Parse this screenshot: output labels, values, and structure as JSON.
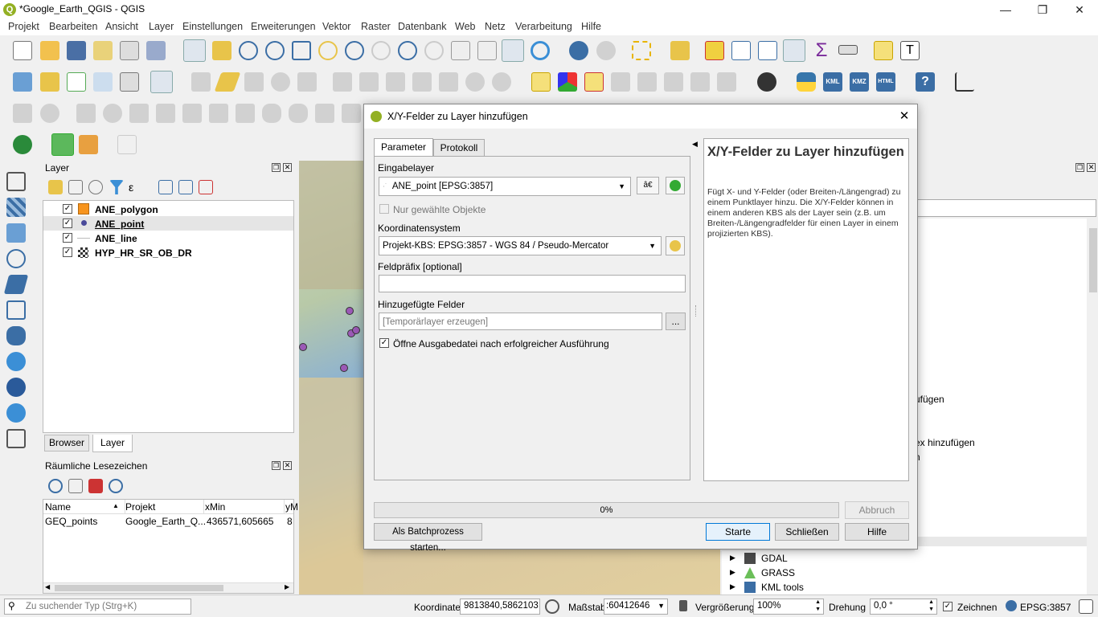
{
  "window": {
    "title": "*Google_Earth_QGIS - QGIS",
    "icon": "qgis-logo-icon"
  },
  "menu": [
    "Projekt",
    "Bearbeiten",
    "Ansicht",
    "Layer",
    "Einstellungen",
    "Erweiterungen",
    "Vektor",
    "Raster",
    "Datenbank",
    "Web",
    "Netz",
    "Verarbeitung",
    "Hilfe"
  ],
  "layers_panel": {
    "title": "Layer",
    "items": [
      {
        "name": "ANE_polygon",
        "checked": true,
        "icon": "polygon-swatch-icon"
      },
      {
        "name": "ANE_point",
        "checked": true,
        "icon": "point-symbol-icon"
      },
      {
        "name": "ANE_line",
        "checked": true,
        "icon": "line-symbol-icon"
      },
      {
        "name": "HYP_HR_SR_OB_DR",
        "checked": true,
        "icon": "raster-icon"
      }
    ],
    "tabs": [
      "Browser",
      "Layer"
    ]
  },
  "bookmarks_panel": {
    "title": "Räumliche Lesezeichen",
    "columns": [
      "Name",
      "Projekt",
      "xMin",
      "yM"
    ],
    "rows": [
      [
        "GEQ_points",
        "Google_Earth_Q...",
        "436571,605665",
        "8"
      ]
    ]
  },
  "toolbox_visible": {
    "items": [
      "GDAL",
      "GRASS",
      "KML tools"
    ],
    "partial_lines": [
      "ufügen",
      "ex hinzufügen",
      "n"
    ]
  },
  "dialog": {
    "title": "X/Y-Felder zu Layer hinzufügen",
    "tabs": [
      "Parameter",
      "Protokoll"
    ],
    "eingabelayer_label": "Eingabelayer",
    "eingabelayer_value": "ANE_point [EPSG:3857]",
    "nur_gewaehlte_label": "Nur gewählte Objekte",
    "koordsys_label": "Koordinatensystem",
    "koordsys_value": "Projekt-KBS: EPSG:3857 - WGS 84 / Pseudo-Mercator",
    "feldpraefix_label": "Feldpräfix [optional]",
    "feldpraefix_value": "",
    "hinzugefuegte_label": "Hinzugefügte Felder",
    "hinzugefuegte_placeholder": "[Temporärlayer erzeugen]",
    "browse_button": "...",
    "open_output_label": "Öffne Ausgabedatei nach erfolgreicher Ausführung",
    "open_output_checked": true,
    "help_title": "X/Y-Felder zu Layer hinzufügen",
    "help_text": "Fügt X- und Y-Felder (oder Breiten-/Längengrad) zu einem Punktlayer hinzu. Die X/Y-Felder können in einem anderen KBS als der Layer sein (z.B. um Breiten-/Längengradfelder für einen Layer in einem projizierten KBS).",
    "progress_percent": 0,
    "progress_label": "0%",
    "abbruch": "Abbruch",
    "batch": "Als Batchprozess starten...",
    "starte": "Starte",
    "schliessen": "Schließen",
    "hilfe": "Hilfe"
  },
  "statusbar": {
    "search_placeholder": "Zu suchender Typ (Strg+K)",
    "koordinate_label": "Koordinate",
    "koordinate_value": "9813840,5862103",
    "massstab_label": "Maßstab",
    "massstab_value": ":60412646",
    "vergroesserung_label": "Vergrößerung",
    "vergroesserung_value": "100%",
    "drehung_label": "Drehung",
    "drehung_value": "0,0 °",
    "zeichnen_label": "Zeichnen",
    "crs": "EPSG:3857"
  },
  "colors": {
    "accent": "#0078d7",
    "polygon_swatch": "#f7941d",
    "point": "#9b59b6"
  }
}
